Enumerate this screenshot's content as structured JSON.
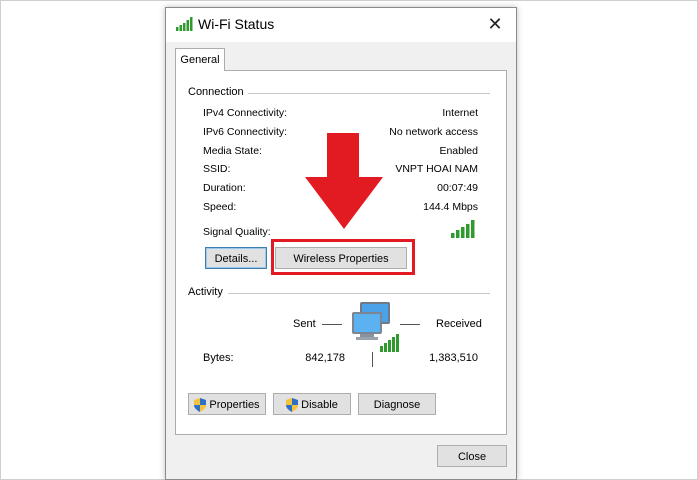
{
  "window": {
    "title": "Wi-Fi Status",
    "close_glyph": "✕"
  },
  "tabs": [
    {
      "label": "General"
    }
  ],
  "connection": {
    "section_label": "Connection",
    "rows": [
      {
        "label": "IPv4 Connectivity:",
        "value": "Internet"
      },
      {
        "label": "IPv6 Connectivity:",
        "value": "No network access"
      },
      {
        "label": "Media State:",
        "value": "Enabled"
      },
      {
        "label": "SSID:",
        "value": "VNPT HOAI NAM"
      },
      {
        "label": "Duration:",
        "value": "00:07:49"
      },
      {
        "label": "Speed:",
        "value": "144.4 Mbps"
      }
    ],
    "signal_label": "Signal Quality:",
    "signal_bars": 5,
    "details_button": "Details...",
    "wireless_properties_button": "Wireless Properties"
  },
  "activity": {
    "section_label": "Activity",
    "sent_label": "Sent",
    "received_label": "Received",
    "bytes_label": "Bytes:",
    "bytes_sent": "842,178",
    "bytes_received": "1,383,510"
  },
  "buttons": {
    "properties": "Properties",
    "disable": "Disable",
    "diagnose": "Diagnose",
    "close": "Close"
  },
  "icons": {
    "title": "wifi-signal-icon",
    "network": "network-computers-icon",
    "shield": "uac-shield-icon",
    "arrow": "red-down-arrow"
  },
  "colors": {
    "highlight": "#e21b23",
    "signal_green": "#2f9b2f",
    "default_button_border": "#3c7fb1"
  }
}
